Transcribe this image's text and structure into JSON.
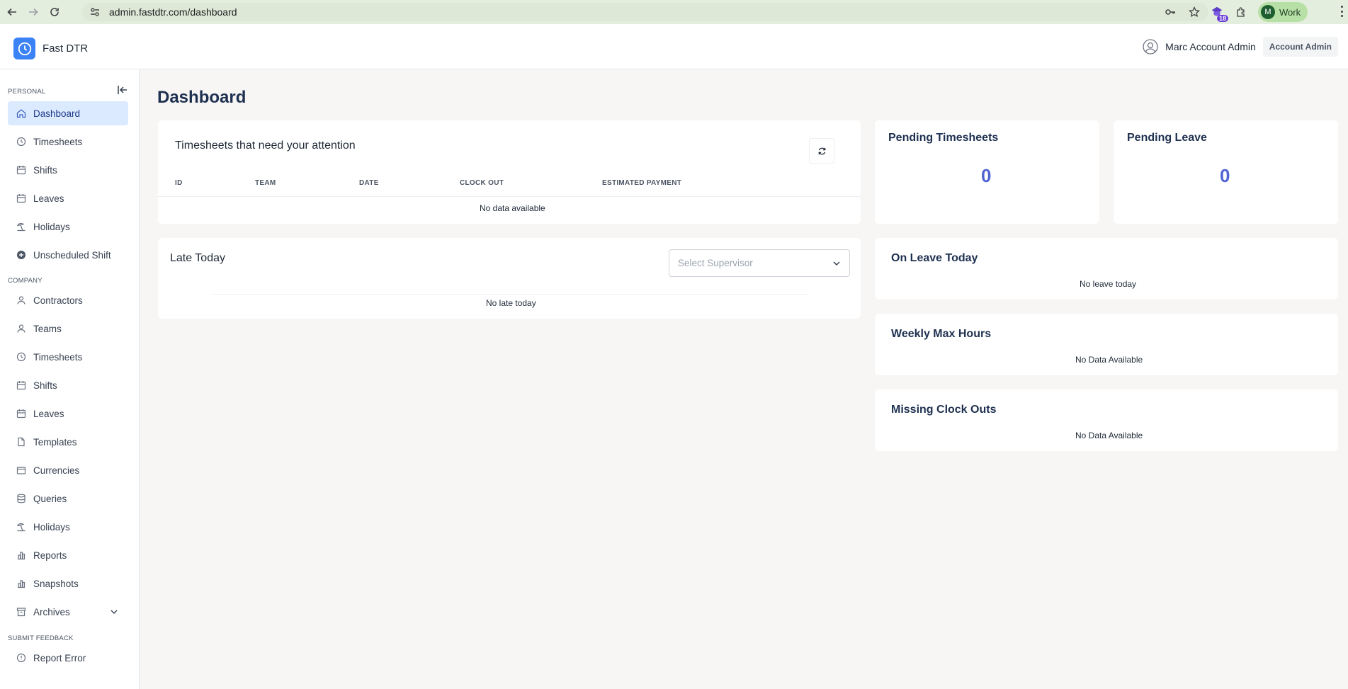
{
  "browser": {
    "url": "admin.fastdtr.com/dashboard",
    "extension_badge": "18",
    "profile_initial": "M",
    "profile_name": "Work"
  },
  "header": {
    "brand": "Fast DTR",
    "user_name": "Marc Account Admin",
    "role": "Account Admin"
  },
  "sidebar": {
    "personal_label": "PERSONAL",
    "company_label": "COMPANY",
    "feedback_label": "SUBMIT FEEDBACK",
    "personal": [
      {
        "label": "Dashboard",
        "icon": "home-icon"
      },
      {
        "label": "Timesheets",
        "icon": "clock-icon"
      },
      {
        "label": "Shifts",
        "icon": "calendar-icon"
      },
      {
        "label": "Leaves",
        "icon": "calendar-icon"
      },
      {
        "label": "Holidays",
        "icon": "beach-umbrella-icon"
      },
      {
        "label": "Unscheduled Shift",
        "icon": "plus-circle-icon"
      }
    ],
    "company": [
      {
        "label": "Contractors",
        "icon": "user-icon"
      },
      {
        "label": "Teams",
        "icon": "users-icon"
      },
      {
        "label": "Timesheets",
        "icon": "clock-icon"
      },
      {
        "label": "Shifts",
        "icon": "calendar-icon"
      },
      {
        "label": "Leaves",
        "icon": "calendar-icon"
      },
      {
        "label": "Templates",
        "icon": "file-icon"
      },
      {
        "label": "Currencies",
        "icon": "wallet-icon"
      },
      {
        "label": "Queries",
        "icon": "database-icon"
      },
      {
        "label": "Holidays",
        "icon": "beach-umbrella-icon"
      },
      {
        "label": "Reports",
        "icon": "bar-chart-icon"
      },
      {
        "label": "Snapshots",
        "icon": "bar-chart-icon"
      },
      {
        "label": "Archives",
        "icon": "archive-icon"
      }
    ],
    "feedback": [
      {
        "label": "Report Error",
        "icon": "alert-circle-icon"
      }
    ]
  },
  "main": {
    "title": "Dashboard",
    "timesheets_card": {
      "title": "Timesheets that need your attention",
      "columns": [
        "ID",
        "TEAM",
        "DATE",
        "CLOCK OUT",
        "ESTIMATED PAYMENT"
      ],
      "empty": "No data available"
    },
    "late_card": {
      "title": "Late Today",
      "select_placeholder": "Select Supervisor",
      "empty": "No late today"
    },
    "pending_timesheets": {
      "title": "Pending Timesheets",
      "value": "0"
    },
    "pending_leave": {
      "title": "Pending Leave",
      "value": "0"
    },
    "on_leave": {
      "title": "On Leave Today",
      "empty": "No leave today"
    },
    "weekly_max": {
      "title": "Weekly Max Hours",
      "empty": "No Data Available"
    },
    "missing_clock": {
      "title": "Missing Clock Outs",
      "empty": "No Data Available"
    }
  },
  "colors": {
    "accent": "#4f63d2",
    "active_nav_bg": "#dbeafe",
    "page_bg": "#f7f6f4"
  }
}
